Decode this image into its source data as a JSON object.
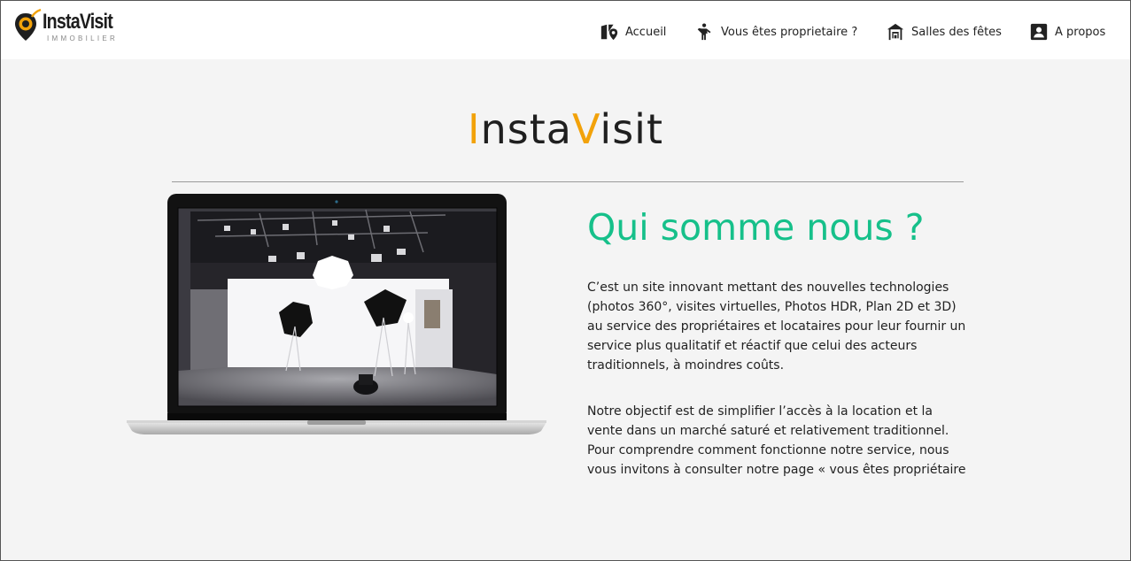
{
  "header": {
    "logo": {
      "name": "InstaVisit",
      "tagline": "IMMOBILIER"
    },
    "nav": [
      {
        "label": "Accueil",
        "icon": "map-pin-icon"
      },
      {
        "label": "Vous êtes proprietaire ?",
        "icon": "person-icon"
      },
      {
        "label": "Salles des fêtes",
        "icon": "hall-icon"
      },
      {
        "label": "A propos",
        "icon": "account-box-icon"
      }
    ]
  },
  "hero": {
    "brand_part1": "I",
    "brand_part2": "nsta",
    "brand_part3": "V",
    "brand_part4": "isit"
  },
  "about": {
    "title": "Qui somme nous ?",
    "paragraph1": "C’est un site innovant mettant des nouvelles technologies (photos 360°, visites virtuelles, Photos HDR, Plan 2D et 3D) au service des propriétaires et locataires pour leur fournir un service plus qualitatif et réactif que celui des acteurs traditionnels, à moindres coûts.",
    "paragraph2": "Notre objectif est de simplifier l’accès à la location et la vente dans un marché saturé et relativement traditionnel. Pour comprendre comment fonctionne notre service, nous vous invitons à consulter notre page « vous êtes propriétaire"
  },
  "colors": {
    "accent_orange": "#f2a20a",
    "accent_green": "#16c08a",
    "background": "#f4f4f4",
    "header_bg": "#ffffff"
  }
}
